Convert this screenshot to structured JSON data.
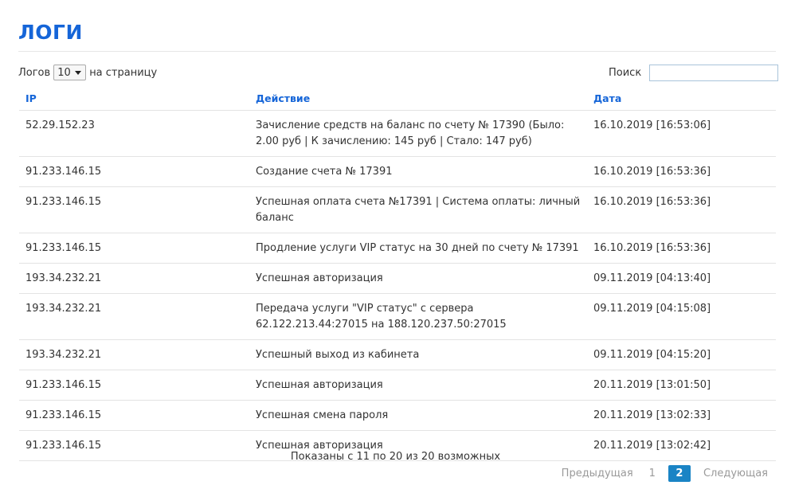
{
  "page": {
    "title": "ЛОГИ"
  },
  "length_menu": {
    "prefix": "Логов",
    "value": "10",
    "suffix": "на страницу"
  },
  "search": {
    "label": "Поиск",
    "value": ""
  },
  "table": {
    "columns": [
      "IP",
      "Действие",
      "Дата"
    ],
    "rows": [
      [
        "52.29.152.23",
        "Зачисление средств на баланс по счету № 17390 (Было: 2.00 руб | К зачислению: 145 руб | Стало: 147 руб)",
        "16.10.2019 [16:53:06]"
      ],
      [
        "91.233.146.15",
        "Создание счета № 17391",
        "16.10.2019 [16:53:36]"
      ],
      [
        "91.233.146.15",
        "Успешная оплата счета №17391 | Система оплаты: личный баланс",
        "16.10.2019 [16:53:36]"
      ],
      [
        "91.233.146.15",
        "Продление услуги VIP статус на 30 дней по счету № 17391",
        "16.10.2019 [16:53:36]"
      ],
      [
        "193.34.232.21",
        "Успешная авторизация",
        "09.11.2019 [04:13:40]"
      ],
      [
        "193.34.232.21",
        "Передача услуги \"VIP статус\" с сервера 62.122.213.44:27015 на 188.120.237.50:27015",
        "09.11.2019 [04:15:08]"
      ],
      [
        "193.34.232.21",
        "Успешный выход из кабинета",
        "09.11.2019 [04:15:20]"
      ],
      [
        "91.233.146.15",
        "Успешная авторизация",
        "20.11.2019 [13:01:50]"
      ],
      [
        "91.233.146.15",
        "Успешная смена пароля",
        "20.11.2019 [13:02:33]"
      ],
      [
        "91.233.146.15",
        "Успешная авторизация",
        "20.11.2019 [13:02:42]"
      ]
    ]
  },
  "info": "Показаны с 11 по 20 из 20 возможных",
  "pagination": {
    "previous": "Предыдущая",
    "pages": [
      "1",
      "2"
    ],
    "current": "2",
    "next": "Следующая"
  },
  "colors": {
    "accent": "#1565d8",
    "pager_active": "#1a84c5",
    "rule": "#e3e3e3"
  }
}
